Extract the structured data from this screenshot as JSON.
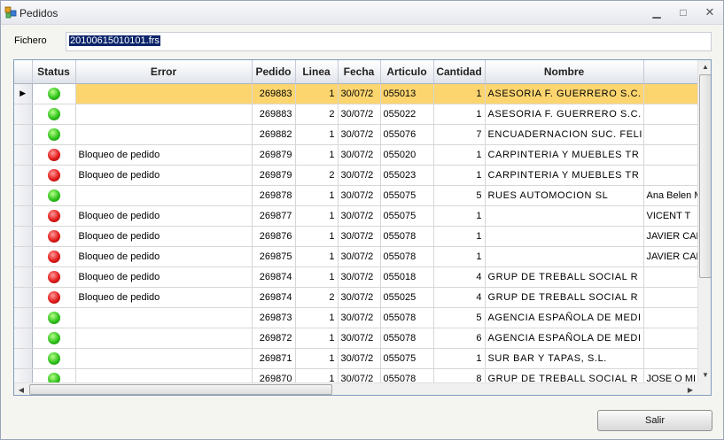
{
  "window": {
    "title": "Pedidos",
    "controls": {
      "minimize": "▁",
      "maximize": "□",
      "close": "✕"
    }
  },
  "fichero": {
    "label": "Fichero",
    "value": "20100615010101.frs"
  },
  "grid": {
    "columns": [
      "Status",
      "Error",
      "Pedido",
      "Linea",
      "Fecha",
      "Articulo",
      "Cantidad",
      "Nombre",
      ""
    ],
    "rows": [
      {
        "status": "green",
        "error": "",
        "pedido": "269883",
        "linea": "1",
        "fecha": "30/07/2",
        "articulo": "055013",
        "cantidad": "1",
        "nombre": "ASESORIA F. GUERRERO S.C.",
        "extra": ""
      },
      {
        "status": "green",
        "error": "",
        "pedido": "269883",
        "linea": "2",
        "fecha": "30/07/2",
        "articulo": "055022",
        "cantidad": "1",
        "nombre": "ASESORIA F. GUERRERO S.C.",
        "extra": ""
      },
      {
        "status": "green",
        "error": "",
        "pedido": "269882",
        "linea": "1",
        "fecha": "30/07/2",
        "articulo": "055076",
        "cantidad": "7",
        "nombre": "ENCUADERNACION SUC. FELI",
        "extra": ""
      },
      {
        "status": "red",
        "error": "Bloqueo de pedido",
        "pedido": "269879",
        "linea": "1",
        "fecha": "30/07/2",
        "articulo": "055020",
        "cantidad": "1",
        "nombre": "CARPINTERIA Y MUEBLES TR",
        "extra": ""
      },
      {
        "status": "red",
        "error": "Bloqueo de pedido",
        "pedido": "269879",
        "linea": "2",
        "fecha": "30/07/2",
        "articulo": "055023",
        "cantidad": "1",
        "nombre": "CARPINTERIA Y MUEBLES TR",
        "extra": ""
      },
      {
        "status": "green",
        "error": "",
        "pedido": "269878",
        "linea": "1",
        "fecha": "30/07/2",
        "articulo": "055075",
        "cantidad": "5",
        "nombre": "RUES AUTOMOCION SL",
        "extra": "Ana Belen M"
      },
      {
        "status": "red",
        "error": "Bloqueo de pedido",
        "pedido": "269877",
        "linea": "1",
        "fecha": "30/07/2",
        "articulo": "055075",
        "cantidad": "1",
        "nombre": "",
        "extra": "VICENT T"
      },
      {
        "status": "red",
        "error": "Bloqueo de pedido",
        "pedido": "269876",
        "linea": "1",
        "fecha": "30/07/2",
        "articulo": "055078",
        "cantidad": "1",
        "nombre": "",
        "extra": "JAVIER CAN"
      },
      {
        "status": "red",
        "error": "Bloqueo de pedido",
        "pedido": "269875",
        "linea": "1",
        "fecha": "30/07/2",
        "articulo": "055078",
        "cantidad": "1",
        "nombre": "",
        "extra": "JAVIER CAN"
      },
      {
        "status": "red",
        "error": "Bloqueo de pedido",
        "pedido": "269874",
        "linea": "1",
        "fecha": "30/07/2",
        "articulo": "055018",
        "cantidad": "4",
        "nombre": "GRUP DE TREBALL SOCIAL R",
        "extra": ""
      },
      {
        "status": "red",
        "error": "Bloqueo de pedido",
        "pedido": "269874",
        "linea": "2",
        "fecha": "30/07/2",
        "articulo": "055025",
        "cantidad": "4",
        "nombre": "GRUP DE TREBALL SOCIAL R",
        "extra": ""
      },
      {
        "status": "green",
        "error": "",
        "pedido": "269873",
        "linea": "1",
        "fecha": "30/07/2",
        "articulo": "055078",
        "cantidad": "5",
        "nombre": "AGENCIA ESPAÑOLA DE MEDI",
        "extra": ""
      },
      {
        "status": "green",
        "error": "",
        "pedido": "269872",
        "linea": "1",
        "fecha": "30/07/2",
        "articulo": "055078",
        "cantidad": "6",
        "nombre": "AGENCIA ESPAÑOLA DE MEDI",
        "extra": ""
      },
      {
        "status": "green",
        "error": "",
        "pedido": "269871",
        "linea": "1",
        "fecha": "30/07/2",
        "articulo": "055075",
        "cantidad": "1",
        "nombre": "SUR BAR Y TAPAS, S.L.",
        "extra": ""
      },
      {
        "status": "green",
        "error": "",
        "pedido": "269870",
        "linea": "1",
        "fecha": "30/07/2",
        "articulo": "055078",
        "cantidad": "8",
        "nombre": "GRUP DE TREBALL SOCIAL R",
        "extra": "JOSE O MI"
      }
    ]
  },
  "footer": {
    "salir_label": "Salir"
  }
}
